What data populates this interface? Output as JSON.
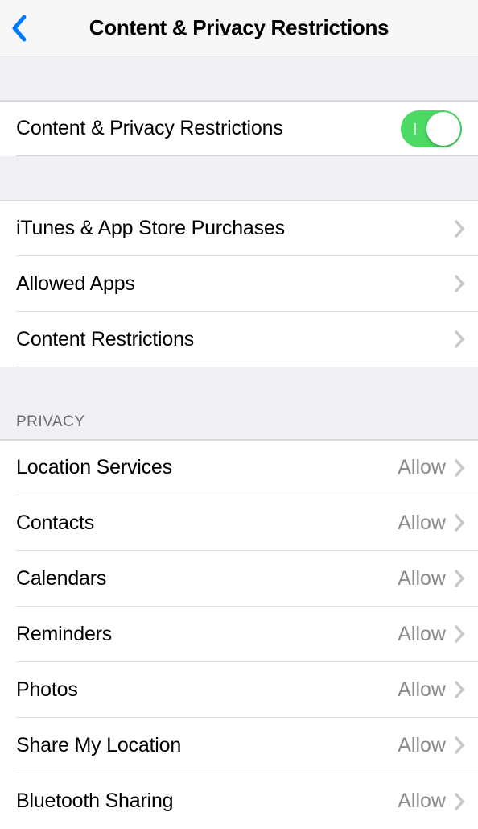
{
  "header": {
    "title": "Content & Privacy Restrictions"
  },
  "main_toggle": {
    "label": "Content & Privacy Restrictions",
    "on": true
  },
  "nav_group": {
    "items": [
      {
        "label": "iTunes & App Store Purchases"
      },
      {
        "label": "Allowed Apps"
      },
      {
        "label": "Content Restrictions"
      }
    ]
  },
  "privacy_group": {
    "header": "PRIVACY",
    "items": [
      {
        "label": "Location Services",
        "value": "Allow"
      },
      {
        "label": "Contacts",
        "value": "Allow"
      },
      {
        "label": "Calendars",
        "value": "Allow"
      },
      {
        "label": "Reminders",
        "value": "Allow"
      },
      {
        "label": "Photos",
        "value": "Allow"
      },
      {
        "label": "Share My Location",
        "value": "Allow"
      },
      {
        "label": "Bluetooth Sharing",
        "value": "Allow"
      }
    ]
  }
}
